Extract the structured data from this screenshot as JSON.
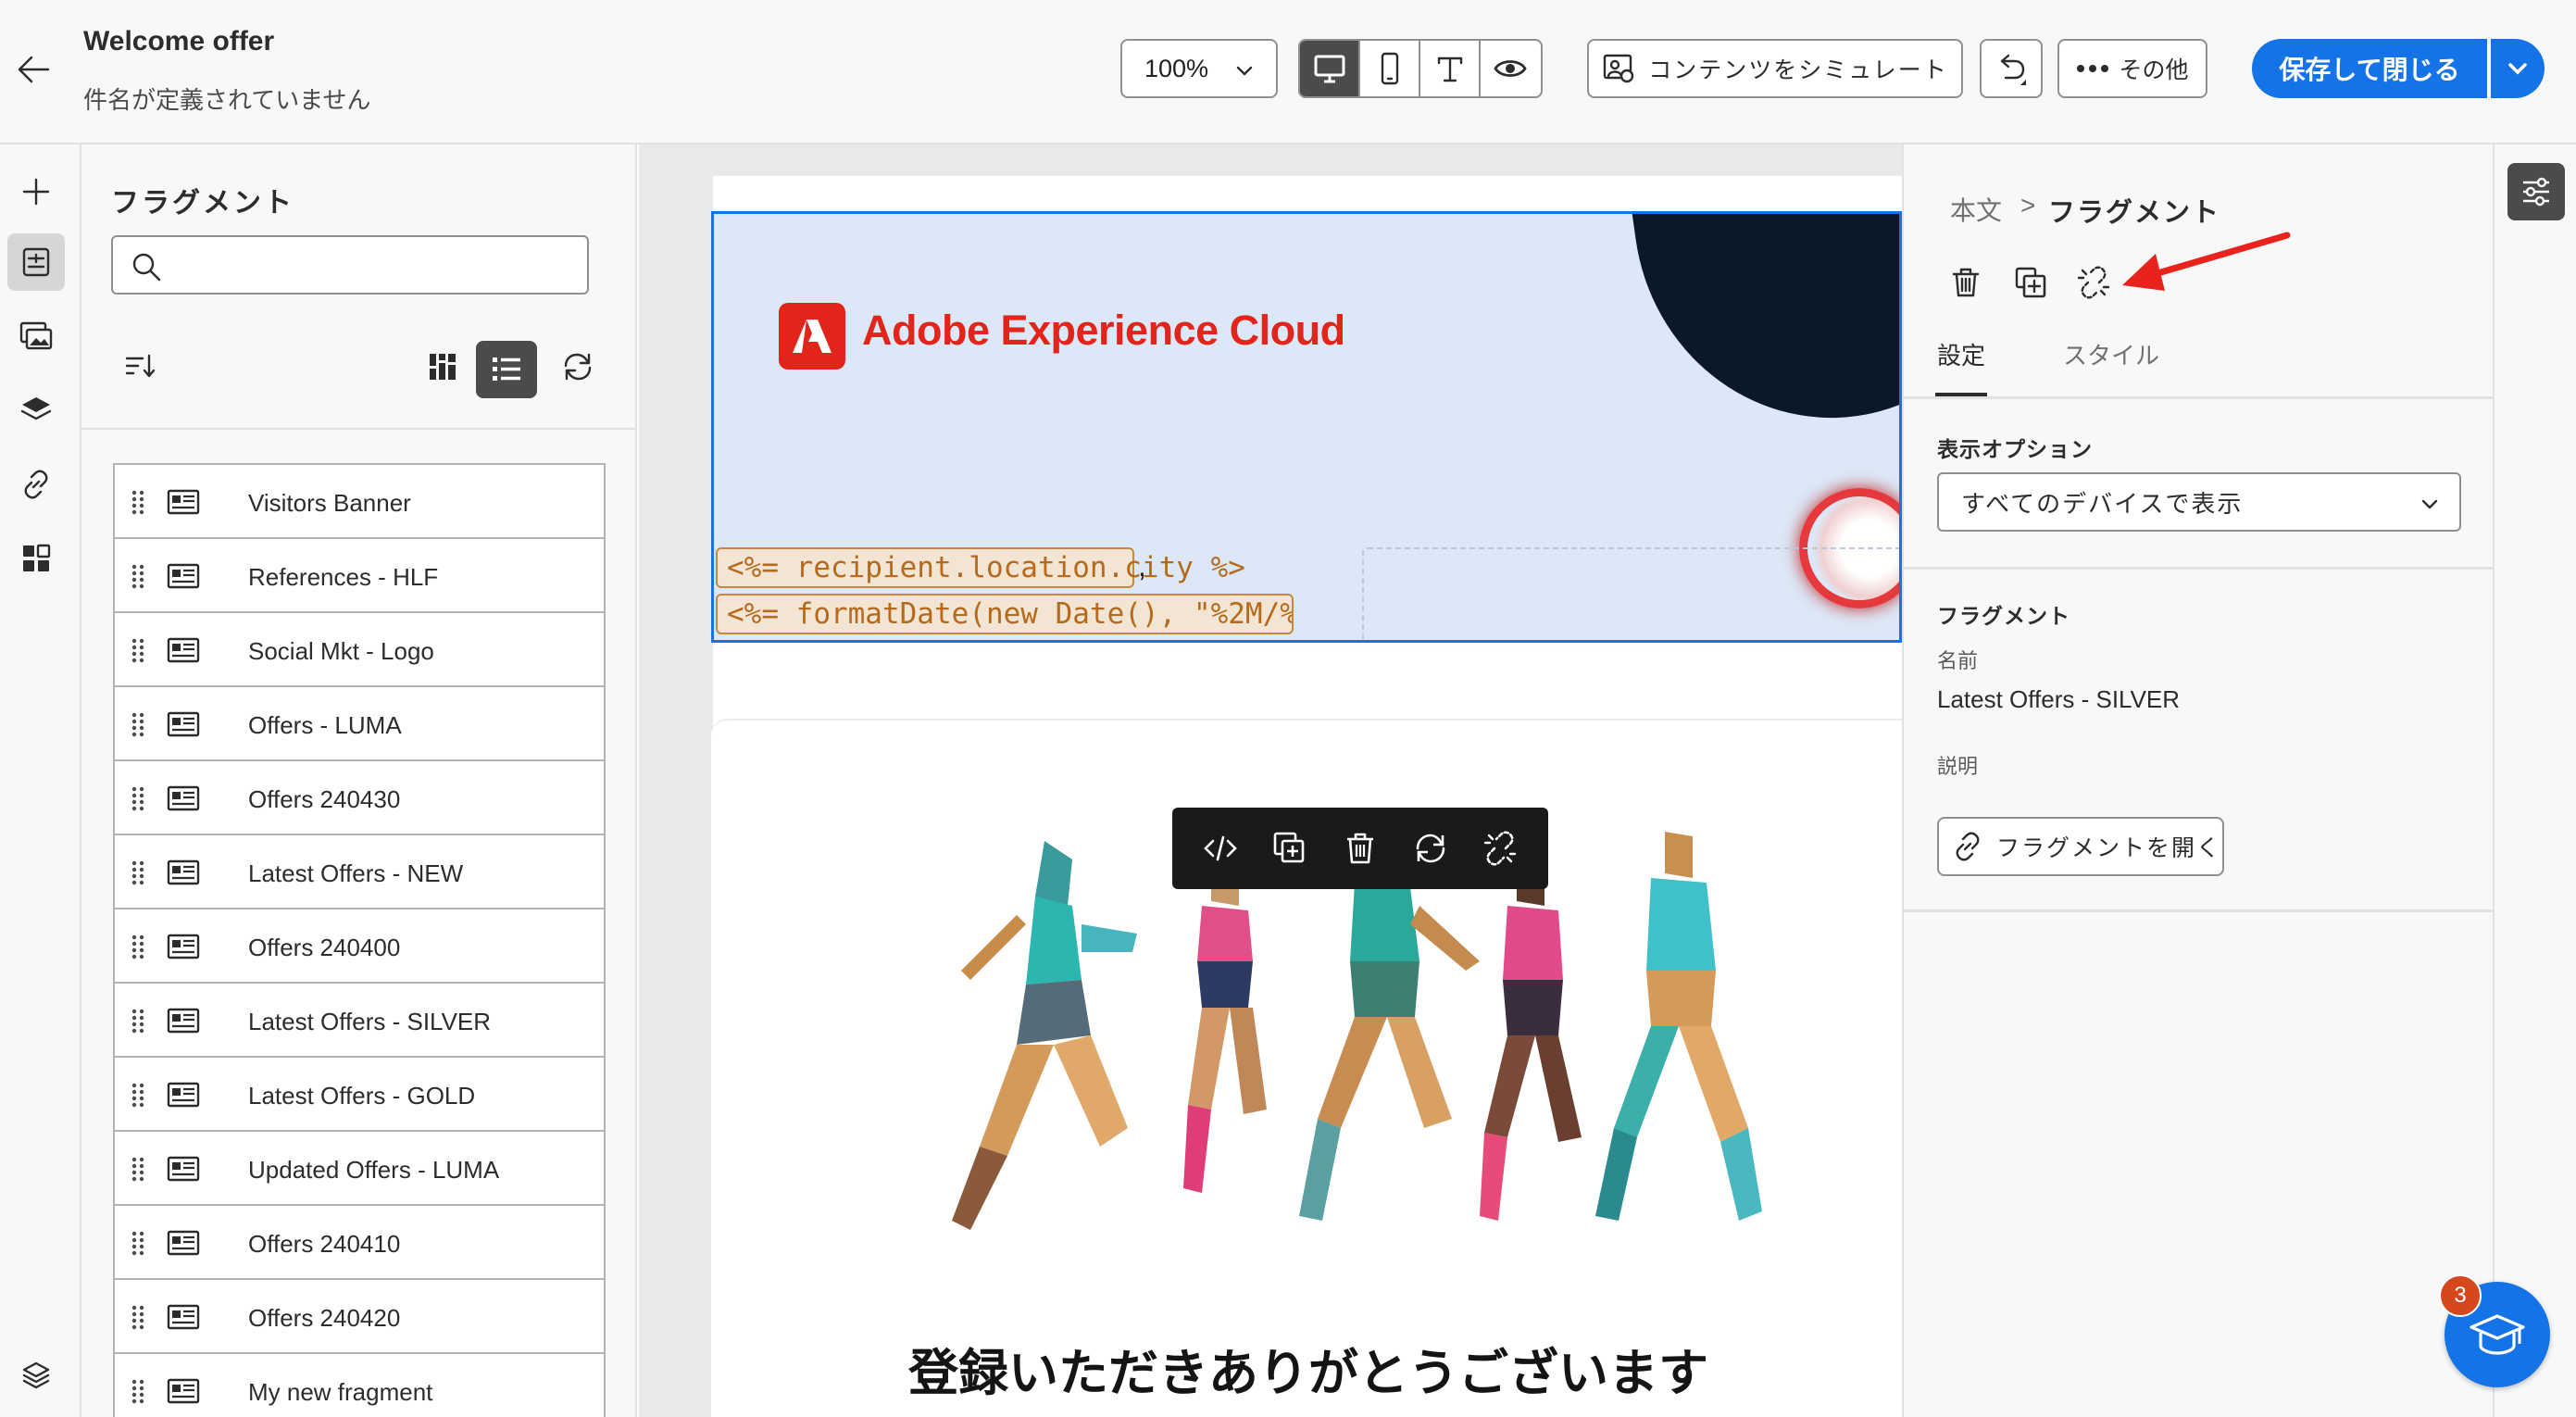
{
  "header": {
    "title": "Welcome offer",
    "subtitle": "件名が定義されていません",
    "zoom": "100%",
    "simulate_label": "コンテンツをシミュレート",
    "more_label": "その他",
    "save_label": "保存して閉じる"
  },
  "fragments_panel": {
    "title": "フラグメント",
    "search_placeholder": "",
    "items": [
      {
        "label": "Visitors Banner"
      },
      {
        "label": "References - HLF"
      },
      {
        "label": "Social Mkt - Logo"
      },
      {
        "label": "Offers - LUMA"
      },
      {
        "label": "Offers 240430"
      },
      {
        "label": "Latest Offers - NEW"
      },
      {
        "label": "Offers 240400"
      },
      {
        "label": "Latest Offers - SILVER"
      },
      {
        "label": "Latest Offers - GOLD"
      },
      {
        "label": "Updated Offers - LUMA"
      },
      {
        "label": "Offers 240410"
      },
      {
        "label": "Offers 240420"
      },
      {
        "label": "My new fragment"
      }
    ]
  },
  "canvas": {
    "brand_name": "Adobe Experience Cloud",
    "expr_city": "<%= recipient.location.city %>",
    "expr_comma": ",",
    "expr_date": "<%= formatDate(new Date(), \"%2M/%2D/...",
    "headline": "登録いただきありがとうございます"
  },
  "properties_panel": {
    "breadcrumb_parent": "本文",
    "breadcrumb_separator": ">",
    "breadcrumb_current": "フラグメント",
    "tab_settings": "設定",
    "tab_style": "スタイル",
    "display_options_label": "表示オプション",
    "display_options_value": "すべてのデバイスで表示",
    "fragment_section_label": "フラグメント",
    "name_label": "名前",
    "name_value": "Latest Offers - SILVER",
    "description_label": "説明",
    "open_fragment_label": "フラグメントを開く"
  },
  "help": {
    "badge_count": "3"
  },
  "colors": {
    "accent": "#1473e6",
    "brand_red": "#e1251b",
    "annotation_arrow": "#e8231e",
    "expression_orange": "#b56a1d"
  }
}
